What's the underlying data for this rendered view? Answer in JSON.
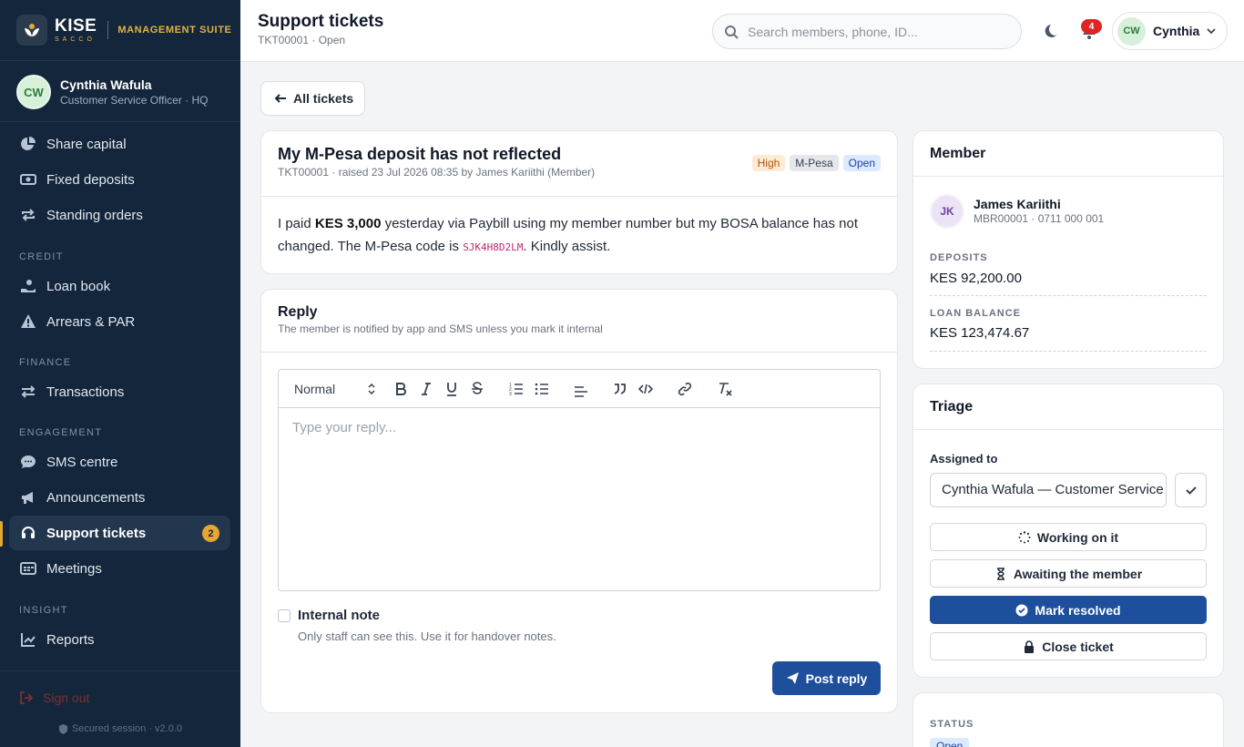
{
  "brand": {
    "name": "KISE",
    "tagline": "SACCO",
    "suite": "MANAGEMENT SUITE"
  },
  "user": {
    "initials": "CW",
    "name": "Cynthia Wafula",
    "role": "Customer Service Officer · HQ",
    "short_name": "Cynthia"
  },
  "nav": {
    "items": [
      {
        "label": "Share capital",
        "icon": "pie-chart-icon"
      },
      {
        "label": "Fixed deposits",
        "icon": "cash-icon"
      },
      {
        "label": "Standing orders",
        "icon": "repeat-icon"
      },
      {
        "label": "Loan book",
        "icon": "hand-coin-icon"
      },
      {
        "label": "Arrears & PAR",
        "icon": "warning-icon"
      },
      {
        "label": "Transactions",
        "icon": "arrows-swap-icon"
      },
      {
        "label": "SMS centre",
        "icon": "chat-icon"
      },
      {
        "label": "Announcements",
        "icon": "megaphone-icon"
      },
      {
        "label": "Support tickets",
        "icon": "headset-icon",
        "badge": "2",
        "active": true
      },
      {
        "label": "Meetings",
        "icon": "calendar-icon"
      },
      {
        "label": "Reports",
        "icon": "line-chart-icon"
      }
    ],
    "sections": {
      "credit": "CREDIT",
      "finance": "FINANCE",
      "engagement": "ENGAGEMENT",
      "insight": "INSIGHT"
    },
    "sign_out": "Sign out",
    "secured": "Secured session · v2.0.0"
  },
  "header": {
    "title": "Support tickets",
    "subtitle": "TKT00001 · Open",
    "search_placeholder": "Search members, phone, ID...",
    "notifications": "4"
  },
  "back_label": "All tickets",
  "ticket": {
    "title": "My M-Pesa deposit has not reflected",
    "meta": "TKT00001 · raised 23 Jul 2026 08:35 by James Kariithi (Member)",
    "tags": {
      "priority": "High",
      "channel": "M-Pesa",
      "status": "Open"
    },
    "body_1": "I paid ",
    "body_amount": "KES 3,000",
    "body_2": " yesterday via Paybill using my member number but my BOSA balance has not changed. The M-Pesa code is ",
    "body_code": "SJK4H8D2LM",
    "body_3": ". Kindly assist."
  },
  "reply": {
    "title": "Reply",
    "subtitle": "The member is notified by app and SMS unless you mark it internal",
    "format": "Normal",
    "placeholder": "Type your reply...",
    "internal_label": "Internal note",
    "internal_help": "Only staff can see this. Use it for handover notes.",
    "post_label": "Post reply"
  },
  "member": {
    "heading": "Member",
    "initials": "JK",
    "name": "James Kariithi",
    "sub": "MBR00001 · 0711 000 001",
    "deposits_label": "DEPOSITS",
    "deposits": "KES 92,200.00",
    "loan_label": "LOAN BALANCE",
    "loan": "KES 123,474.67"
  },
  "triage": {
    "heading": "Triage",
    "assigned_label": "Assigned to",
    "assigned_value": "Cynthia Wafula — Customer Service Officer",
    "working": "Working on it",
    "awaiting": "Awaiting the member",
    "resolve": "Mark resolved",
    "close": "Close ticket"
  },
  "status": {
    "label": "STATUS",
    "value": "Open"
  },
  "colors": {
    "sidebar": "#13263b",
    "accent": "#e3a732",
    "primary": "#1d4f9c",
    "danger": "#dc2626"
  }
}
